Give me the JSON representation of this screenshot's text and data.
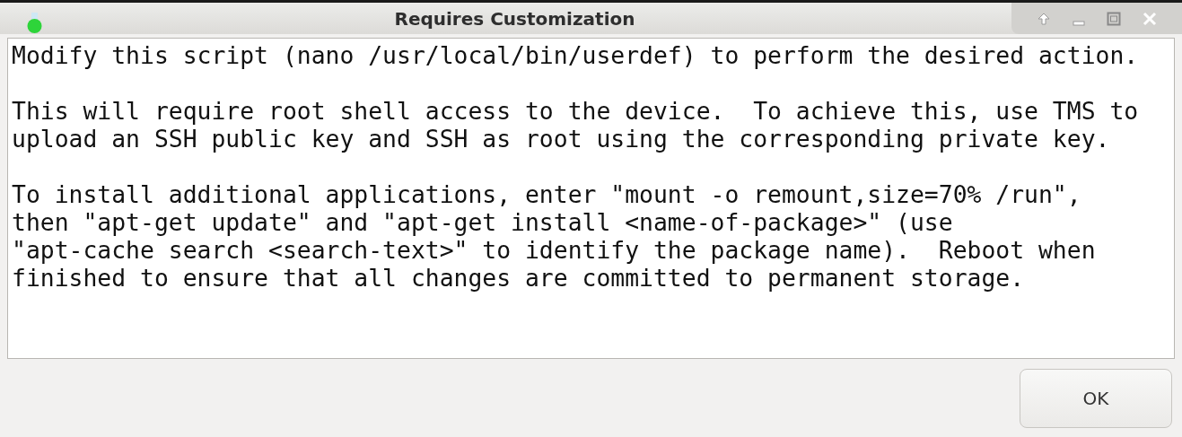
{
  "window": {
    "title": "Requires Customization"
  },
  "message": {
    "paragraphs": [
      [
        "Modify this script (nano /usr/local/bin/userdef) to perform the desired action."
      ],
      [
        "This will require root shell access to the device.  To achieve this, use TMS to",
        "upload an SSH public key and SSH as root using the corresponding private key."
      ],
      [
        "To install additional applications, enter \"mount -o remount,size=70% /run\",",
        "then \"apt-get update\" and \"apt-get install <name-of-package>\" (use",
        "\"apt-cache search <search-text>\" to identify the package name).  Reboot when",
        "finished to ensure that all changes are committed to permanent storage."
      ]
    ]
  },
  "buttons": [
    "OK"
  ]
}
